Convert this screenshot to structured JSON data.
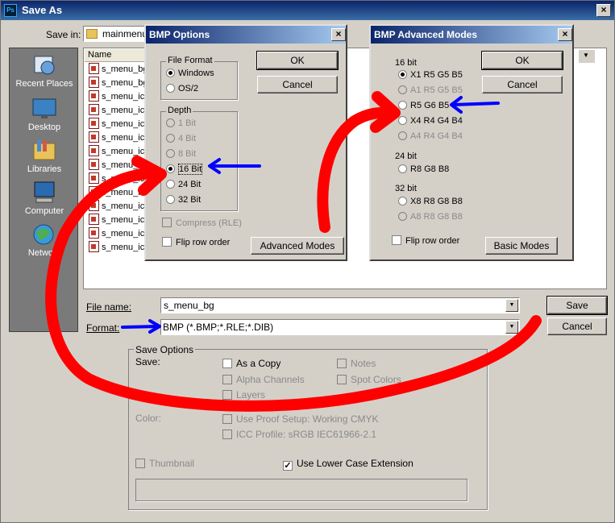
{
  "app": {
    "title": "Save As",
    "icon": "photoshop-icon"
  },
  "save_in": {
    "label": "Save in:",
    "folder": "mainmenu"
  },
  "places": [
    {
      "label": "Recent Places",
      "icon": "recent-places-icon"
    },
    {
      "label": "Desktop",
      "icon": "desktop-icon"
    },
    {
      "label": "Libraries",
      "icon": "libraries-icon"
    },
    {
      "label": "Computer",
      "icon": "computer-icon"
    },
    {
      "label": "Network",
      "icon": "network-icon"
    }
  ],
  "file_list": {
    "column_name": "Name",
    "files": [
      "s_menu_bg",
      "s_menu_bg",
      "s_menu_ic",
      "s_menu_ic",
      "s_menu_ic",
      "s_menu_ic",
      "s_menu_ic",
      "s_menu_ic",
      "s_menu_ic",
      "s_menu_ic",
      "s_menu_ic",
      "s_menu_ic",
      "s_menu_ic",
      "s_menu_ic"
    ]
  },
  "file_name": {
    "label": "File name:",
    "value": "s_menu_bg"
  },
  "format": {
    "label": "Format:",
    "value": "BMP (*.BMP;*.RLE;*.DIB)"
  },
  "buttons": {
    "save": "Save",
    "cancel": "Cancel"
  },
  "save_options": {
    "title": "Save Options",
    "save_label": "Save:",
    "as_a_copy": "As a Copy",
    "notes": "Notes",
    "alpha_channels": "Alpha Channels",
    "spot_colors": "Spot Colors",
    "layers": "Layers",
    "color_label": "Color:",
    "use_proof_setup": "Use Proof Setup:  Working CMYK",
    "icc_profile": "ICC Profile:  sRGB IEC61966-2.1",
    "thumbnail": "Thumbnail",
    "use_lower_case": "Use Lower Case Extension"
  },
  "bmp_options": {
    "title": "BMP Options",
    "file_format_title": "File Format",
    "windows": "Windows",
    "os2": "OS/2",
    "depth_title": "Depth",
    "depths": [
      "1 Bit",
      "4 Bit",
      "8 Bit",
      "16 Bit",
      "24 Bit",
      "32 Bit"
    ],
    "selected_depth": "16 Bit",
    "compress": "Compress (RLE)",
    "flip_row_order": "Flip row order",
    "ok": "OK",
    "cancel": "Cancel",
    "advanced_modes": "Advanced Modes"
  },
  "bmp_advanced": {
    "title": "BMP Advanced Modes",
    "group16": "16 bit",
    "modes16": [
      "X1 R5 G5 B5",
      "A1 R5 G5 B5",
      "R5 G6 B5",
      "X4 R4 G4 B4",
      "A4 R4 G4 B4"
    ],
    "group24": "24 bit",
    "modes24": [
      "R8 G8 B8"
    ],
    "group32": "32 bit",
    "modes32": [
      "X8 R8 G8 B8",
      "A8 R8 G8 B8"
    ],
    "flip_row_order": "Flip row order",
    "ok": "OK",
    "cancel": "Cancel",
    "basic_modes": "Basic Modes"
  },
  "colors": {
    "annotation_red": "#ff0000",
    "annotation_blue": "#0000ff",
    "title_blue": "#0a246a"
  }
}
